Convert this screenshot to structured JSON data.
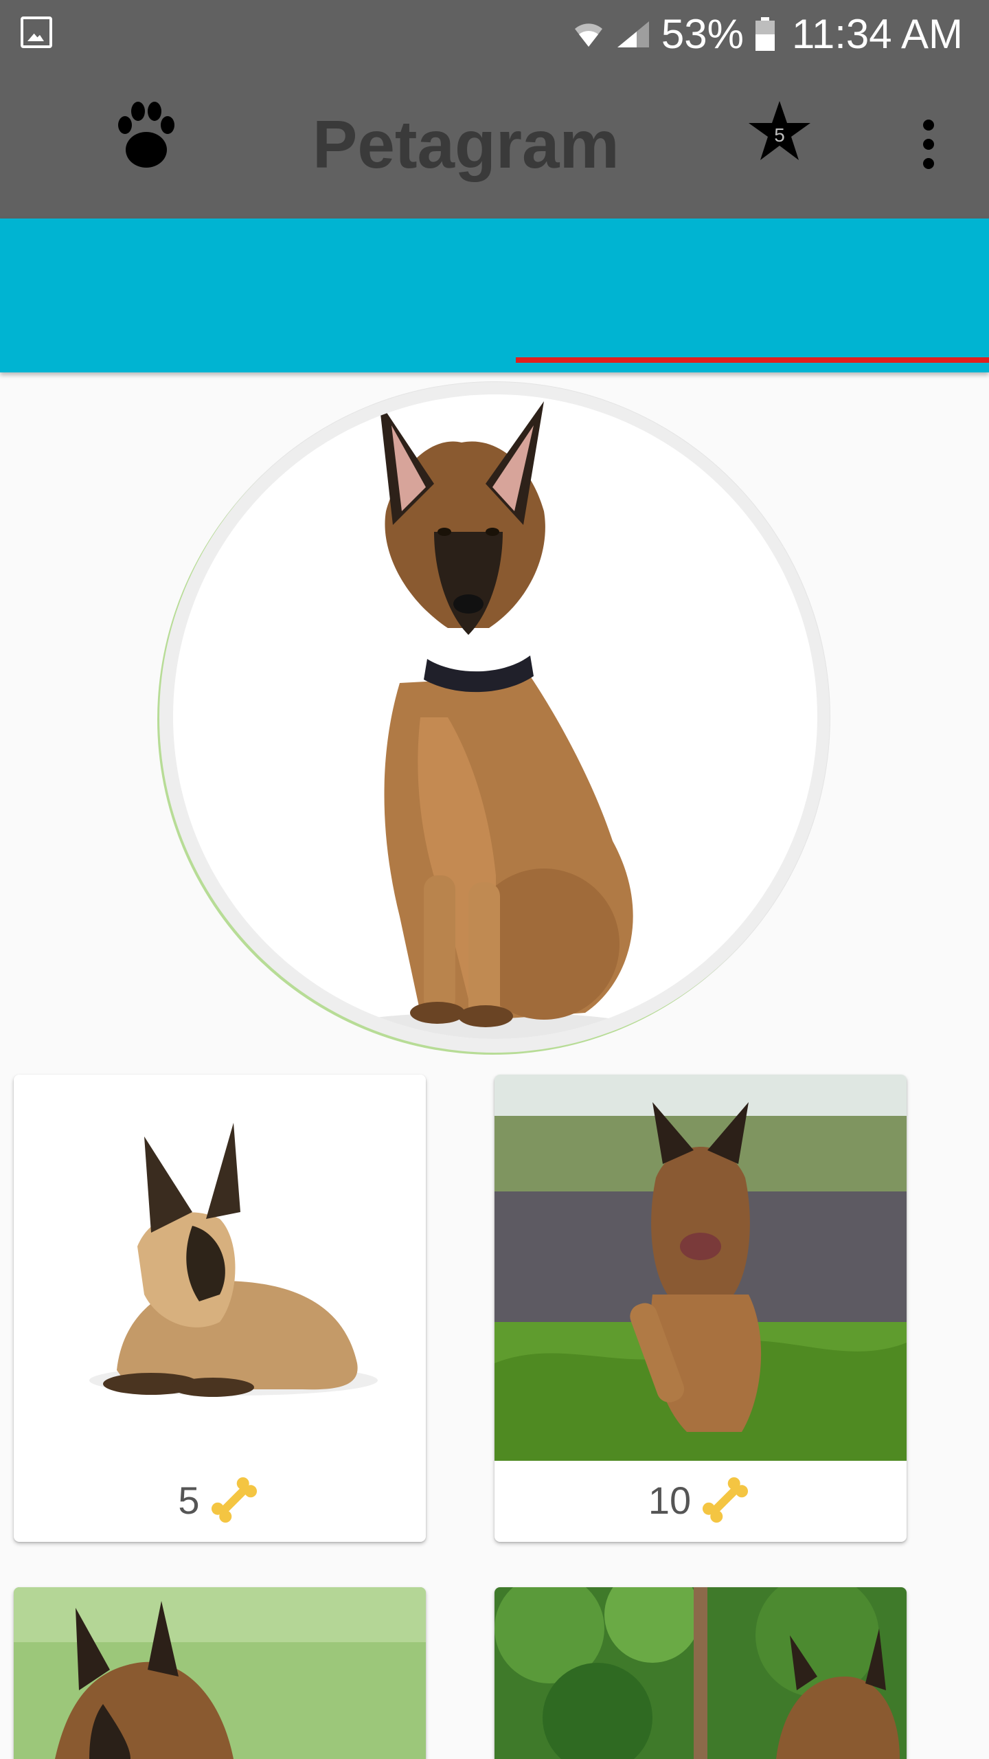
{
  "status_bar": {
    "battery_percent": "53%",
    "time": "11:34 AM",
    "icons": [
      "image-notification-icon",
      "wifi-icon",
      "cell-signal-icon",
      "battery-icon"
    ]
  },
  "app_bar": {
    "title": "Petagram",
    "favorites_count": "5",
    "icons": [
      "paw-icon",
      "star-badge-icon",
      "more-options-icon"
    ]
  },
  "colors": {
    "status_bar": "#616161",
    "app_bar": "#616161",
    "tab_strip": "#00b4d2",
    "tab_indicator": "#e0201e",
    "profile_ring": "#b7dc96"
  },
  "profile": {
    "photo": "belgian-malinois-sitting"
  },
  "grid": {
    "cards": [
      {
        "photo": "malinois-puppy-lying",
        "likes": "5",
        "icon": "bone-icon"
      },
      {
        "photo": "malinois-running-grass",
        "likes": "10",
        "icon": "bone-icon"
      },
      {
        "photo": "malinois-on-lawn",
        "likes": "",
        "icon": "bone-icon"
      },
      {
        "photo": "malinois-in-forest",
        "likes": "",
        "icon": "bone-icon"
      }
    ]
  }
}
